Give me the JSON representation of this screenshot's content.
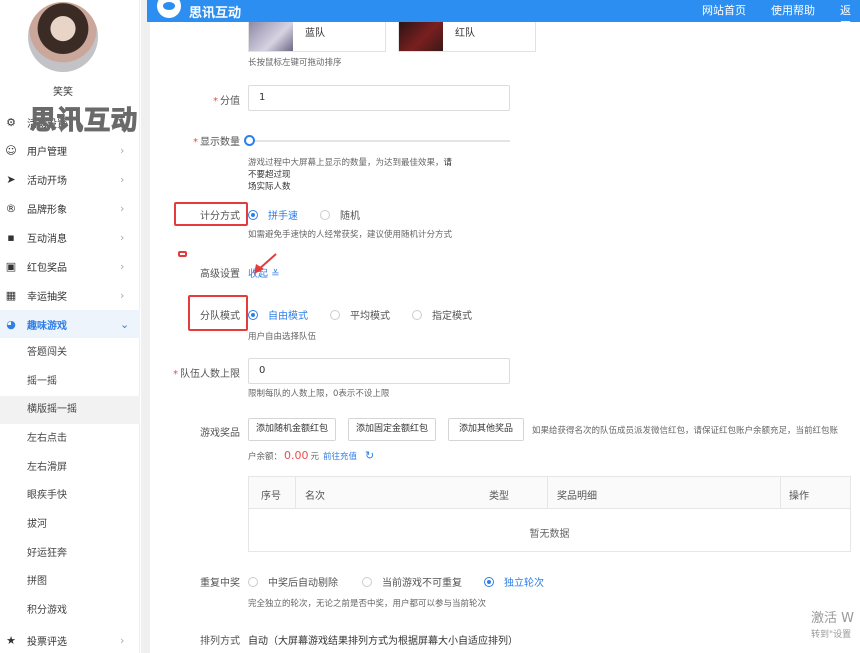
{
  "topbar": {
    "title": "思讯互动",
    "links": [
      "网站首页",
      "使用帮助",
      "返回"
    ]
  },
  "user": {
    "name": "笑笑"
  },
  "watermark": "思讯互动",
  "menu": [
    {
      "label": "活动设置",
      "icon": "gear-icon"
    },
    {
      "label": "用户管理",
      "icon": "user-icon"
    },
    {
      "label": "活动开场",
      "icon": "send-icon"
    },
    {
      "label": "品牌形象",
      "icon": "brand-icon"
    },
    {
      "label": "互动消息",
      "icon": "message-icon"
    },
    {
      "label": "红包奖品",
      "icon": "redpacket-icon"
    },
    {
      "label": "幸运抽奖",
      "icon": "lottery-icon"
    },
    {
      "label": "趣味游戏",
      "icon": "game-icon"
    }
  ],
  "submenu": [
    "答题闯关",
    "摇一摇",
    "横版摇一摇",
    "左右点击",
    "左右滑屏",
    "眼疾手快",
    "拔河",
    "好运狂奔",
    "拼图",
    "积分游戏"
  ],
  "menu_bottom": {
    "label": "投票评选",
    "icon": "star-icon"
  },
  "teams": [
    {
      "name": "蓝队"
    },
    {
      "name": "红队"
    }
  ],
  "drag_hint": "长按鼠标左键可拖动排序",
  "score": {
    "label": "分值",
    "value": "1"
  },
  "display_count": {
    "label": "显示数量",
    "slider_fraction": 0,
    "hint_plain": "游戏过程中大屏幕上显示的数量，为达到最佳效果，",
    "hint_strong": "请不要超过现",
    "hint_line2": "场实际人数"
  },
  "scoring": {
    "label": "计分方式",
    "options": [
      "拼手速",
      "随机"
    ],
    "selected": 0,
    "hint": "如需避免手速快的人经常获奖，建议使用随机计分方式"
  },
  "advanced": {
    "label": "高级设置",
    "toggle": "收起",
    "chevron": "chevron-down-icon"
  },
  "team_mode": {
    "label": "分队模式",
    "options": [
      "自由模式",
      "平均模式",
      "指定模式"
    ],
    "selected": 0,
    "hint": "用户自由选择队伍"
  },
  "team_limit": {
    "label": "队伍人数上限",
    "value": "0",
    "hint": "限制每队的人数上限，0表示不设上限"
  },
  "prizes": {
    "label": "游戏奖品",
    "buttons": [
      "添加随机金额红包",
      "添加固定金额红包",
      "添加其他奖品"
    ],
    "hint": "如果给获得名次的队伍成员派发微信红包，请保证红包账户余额充足，当前红包账",
    "balance_prefix": "户余额：",
    "balance_value": "0.00",
    "balance_unit": "元",
    "recharge": "前往充值",
    "refresh_icon": "refresh-icon"
  },
  "table": {
    "columns": [
      "序号",
      "名次",
      "类型",
      "奖品明细",
      "操作"
    ],
    "empty": "暂无数据"
  },
  "repeat": {
    "label": "重复中奖",
    "options": [
      "中奖后自动剔除",
      "当前游戏不可重复",
      "独立轮次"
    ],
    "selected": 2,
    "hint": "完全独立的轮次，无论之前是否中奖，用户都可以参与当前轮次"
  },
  "sort": {
    "label": "排列方式",
    "value": "自动（大屏幕游戏结果排列方式为根据屏幕大小自适应排列）"
  },
  "activation": {
    "line1": "激活 W",
    "line2": "转到\"设置"
  },
  "colors": {
    "primary": "#2c8ef0",
    "accent": "#2f7fe8",
    "annotation": "#e43c3c",
    "balance": "#f04a4a"
  }
}
